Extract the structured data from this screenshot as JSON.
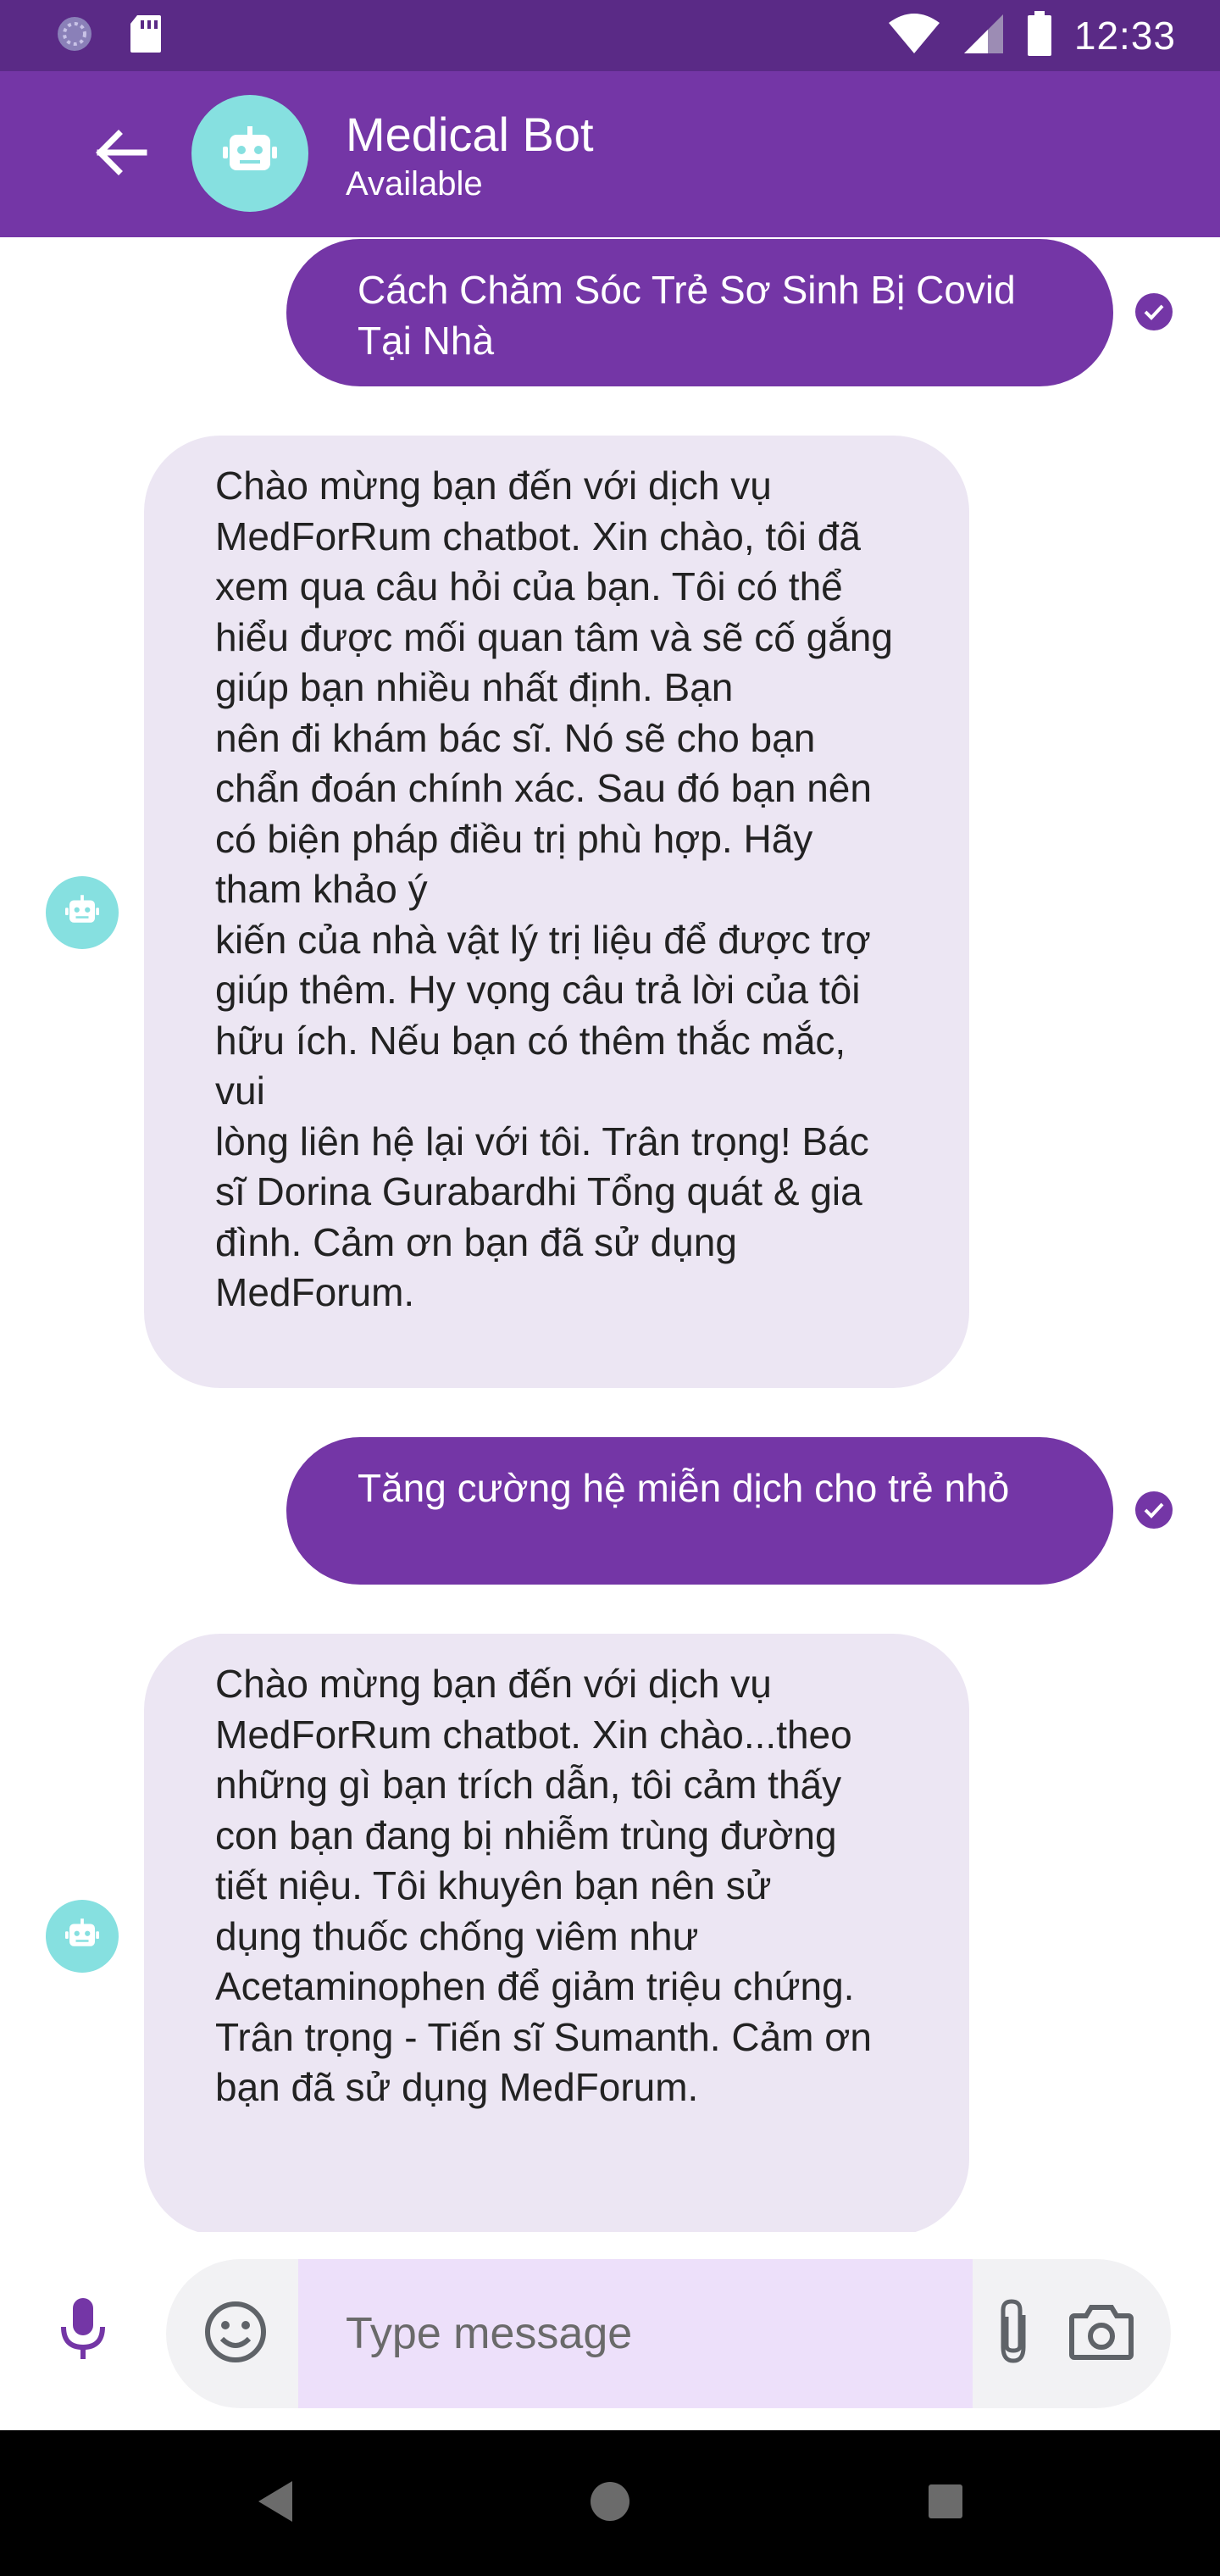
{
  "status_bar": {
    "time": "12:33",
    "icons": [
      "sync-icon",
      "sd-card-icon",
      "wifi-icon",
      "signal-icon",
      "battery-icon"
    ]
  },
  "header": {
    "title": "Medical Bot",
    "subtitle": "Available",
    "back_icon": "arrow-left-icon",
    "avatar_icon": "robot-icon"
  },
  "messages": [
    {
      "sender": "user",
      "text": "Cách Chăm Sóc Trẻ Sơ Sinh Bị Covid Tại Nhà",
      "status_icon": "check-circle-icon"
    },
    {
      "sender": "bot",
      "text": "Chào mừng bạn đến với dịch vụ MedForRum chatbot. Xin chào, tôi đã xem qua câu hỏi của bạn. Tôi có thể hiểu được mối quan tâm và sẽ cố gắng giúp bạn nhiều nhất định. Bạn\nnên đi khám bác sĩ. Nó sẽ cho bạn chẩn đoán chính xác. Sau đó bạn nên có biện pháp điều trị phù hợp. Hãy tham khảo ý\nkiến của nhà vật lý trị liệu để được trợ giúp thêm. Hy vọng câu trả lời của tôi hữu ích. Nếu bạn có thêm thắc mắc, vui\nlòng liên hệ lại với tôi. Trân trọng! Bác sĩ Dorina Gurabardhi Tổng quát & gia đình. Cảm ơn bạn đã sử dụng MedForum."
    },
    {
      "sender": "user",
      "text": "Tăng cường hệ miễn dịch cho trẻ nhỏ",
      "status_icon": "check-circle-icon"
    },
    {
      "sender": "bot",
      "text": "Chào mừng bạn đến với dịch vụ MedForRum chatbot. Xin chào...theo những gì bạn trích dẫn, tôi cảm thấy con bạn đang bị nhiễm trùng đường tiết niệu. Tôi khuyên bạn nên sử\ndụng thuốc chống viêm như Acetaminophen để giảm triệu chứng. Trân trọng - Tiến sĩ Sumanth. Cảm ơn bạn đã sử dụng MedForum."
    }
  ],
  "composer": {
    "placeholder": "Type message",
    "mic_icon": "microphone-icon",
    "emoji_icon": "emoji-icon",
    "attach_icon": "paperclip-icon",
    "camera_icon": "camera-icon"
  },
  "nav_bar": {
    "buttons": [
      "back-triangle-icon",
      "home-circle-icon",
      "recents-square-icon"
    ]
  },
  "colors": {
    "status_bar": "#5a2a86",
    "app_bar": "#7436a6",
    "user_bubble": "#7436a6",
    "bot_bubble": "#ece6f3",
    "bot_avatar": "#86e0e0",
    "input_highlight": "#ede0fa"
  }
}
